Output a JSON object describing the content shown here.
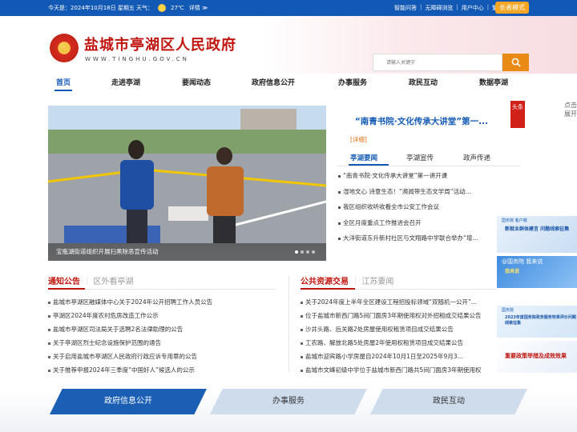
{
  "topbar": {
    "date": "今天是：2024年10月18日 星期五",
    "weather_label": "天气：",
    "weather_temp": "27℃",
    "weather_link": "详情 ≫",
    "links": [
      "智能问答",
      "无障碍浏览",
      "用户中心",
      "繁體"
    ],
    "elder_mode": "长者模式"
  },
  "header": {
    "title": "盐城市亭湖区人民政府",
    "url": "WWW.TINGHU.GOV.CN",
    "search_placeholder": "请输入关键字"
  },
  "nav": [
    "首页",
    "走进亭湖",
    "要闻动态",
    "政府信息公开",
    "办事服务",
    "政民互动",
    "数据亭湖"
  ],
  "slider": {
    "caption": "宝瓶湖街道组织开展扫黑除恶宣传活动"
  },
  "news_panel": {
    "badge": "头条",
    "headline": "“南青书院·文化传承大讲堂”第一...",
    "detail": "[详细]",
    "tabs": [
      "亭湖要闻",
      "亭湖宣传",
      "政声传递"
    ],
    "items": [
      "“南青书院·文化传承大讲堂”第一讲开课",
      "湿地文心 诗意生态！“濒闻带生态文学周”活动...",
      "我区组织收听收看全市公安工作会议",
      "全区月度重点工作推进会召开",
      "大洋街道东升新村社区与文翔路中学联合举办“增..."
    ]
  },
  "side": {
    "expand": "点击展开",
    "banners": [
      {
        "tag": "国务院 客户端",
        "text": "新就业群体建言 问题线索征集"
      },
      {
        "tag": "@国务院 我来说",
        "text": "我来说"
      },
      {
        "tag": "国务院",
        "text": "2023年度国务院政务服务效果评价问题线索征集"
      },
      {
        "tag": "",
        "text": "重要政策举措及成效效果"
      }
    ]
  },
  "section_left": {
    "title": "通知公告",
    "sub": "区外看亭湖",
    "items": [
      "盐城市亭湖区融媒体中心关于2024年公开招聘工作人员公告",
      "亭湖区2024年度农村危房改造工作公示",
      "盐城市亭湖区司法局关于选聘2名法律助理的公告",
      "关于亭湖区烈士纪念设施保护范围的通告",
      "关于启用盐城市亭湖区人民政府行政应诉专用章的公告",
      "关于推荐申报2024年三季度“中国好人”候选人的公示"
    ]
  },
  "section_right": {
    "title": "公共资源交易",
    "sub": "江苏要闻",
    "items": [
      "关于2024年度上半年全区建设工程招投标领域“双随机一公开”...",
      "位于盐城市新西门路5间门面房3年期使用权对外招租成交结果公告",
      "沙井头路、后关路2处房屋使用权租赁项目成交结果公告",
      "工农路、解放北路5处房屋2年使用权租赁项目成交结果公告",
      "盐城市迎宾路小学房屋自2024年10月1日至2025年9月3...",
      "盐城市文峰初级中学位于盐城市新西门路共5间门面房3年期使用权"
    ]
  },
  "bottom_tabs": [
    "政府信息公开",
    "办事服务",
    "政民互动"
  ]
}
